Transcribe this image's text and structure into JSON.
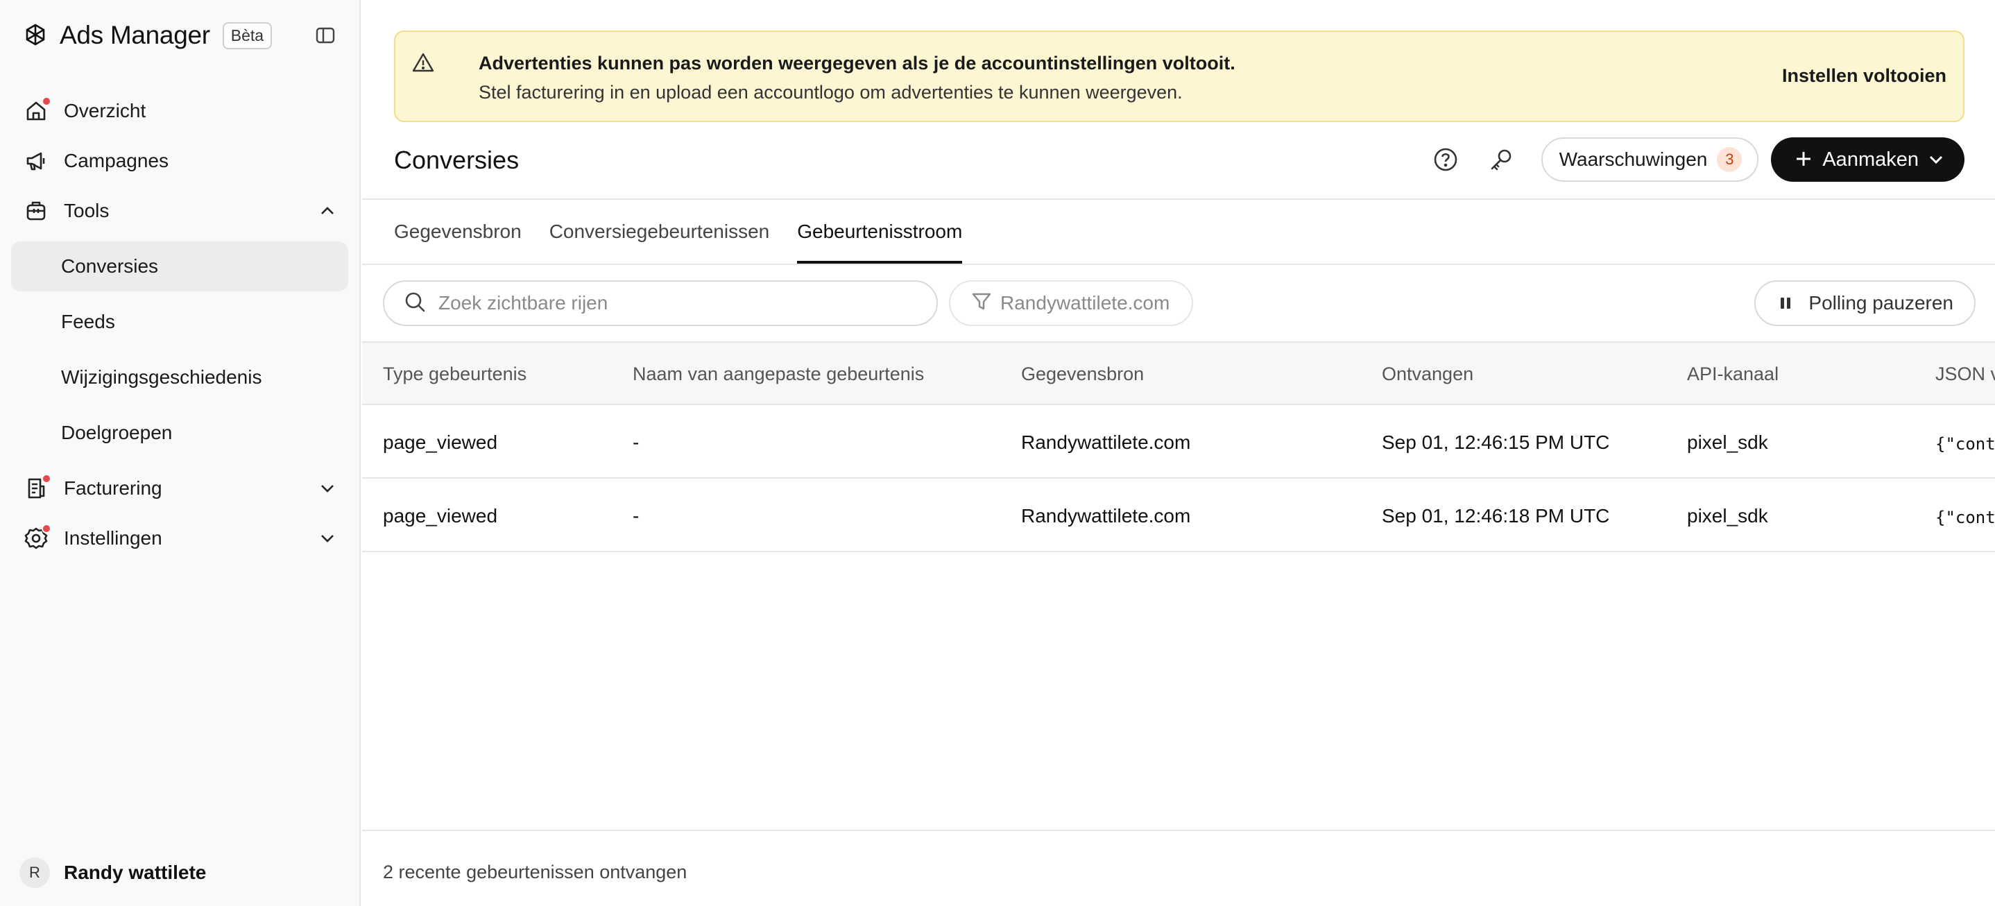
{
  "app": {
    "name": "Ads Manager",
    "badge": "Bèta"
  },
  "sidebar": {
    "items": [
      {
        "label": "Overzicht",
        "icon": "home-icon",
        "notification": true
      },
      {
        "label": "Campagnes",
        "icon": "megaphone-icon",
        "notification": false
      },
      {
        "label": "Tools",
        "icon": "toolbox-icon",
        "notification": false,
        "expanded": true,
        "children": [
          "Conversies",
          "Feeds",
          "Wijzigingsgeschiedenis",
          "Doelgroepen"
        ],
        "active_child": "Conversies"
      },
      {
        "label": "Facturering",
        "icon": "billing-icon",
        "notification": true,
        "expanded": false
      },
      {
        "label": "Instellingen",
        "icon": "settings-gear-icon",
        "notification": true,
        "expanded": false
      }
    ],
    "user": {
      "initial": "R",
      "name": "Randy wattilete"
    }
  },
  "banner": {
    "title": "Advertenties kunnen pas worden weergegeven als je de accountinstellingen voltooit.",
    "message": "Stel facturering in en upload een accountlogo om advertenties te kunnen weergeven.",
    "action": "Instellen voltooien",
    "icon": "warning-triangle-icon",
    "color": "#fdf6d3"
  },
  "header": {
    "title": "Conversies",
    "warnings_label": "Waarschuwingen",
    "warnings_count": "3",
    "create_label": "Aanmaken"
  },
  "tabs": [
    {
      "label": "Gegevensbron",
      "active": false
    },
    {
      "label": "Conversiegebeurtenissen",
      "active": false
    },
    {
      "label": "Gebeurtenisstroom",
      "active": true
    }
  ],
  "toolbar": {
    "search_placeholder": "Zoek zichtbare rijen",
    "filter_label": "Randywattilete.com",
    "polling_label": "Polling pauzeren"
  },
  "table": {
    "columns": [
      "Type gebeurtenis",
      "Naam van aangepaste gebeurtenis",
      "Gegevensbron",
      "Ontvangen",
      "API-kanaal",
      "JSON v"
    ],
    "rows": [
      [
        "page_viewed",
        "-",
        "Randywattilete.com",
        "Sep 01, 12:46:15 PM UTC",
        "pixel_sdk",
        "{\"cont"
      ],
      [
        "page_viewed",
        "-",
        "Randywattilete.com",
        "Sep 01, 12:46:18 PM UTC",
        "pixel_sdk",
        "{\"cont"
      ]
    ]
  },
  "footer": {
    "status": "2 recente gebeurtenissen ontvangen"
  },
  "colors": {
    "primary_button": "#111111",
    "notification_dot": "#e5484d",
    "warning_badge_bg": "#fde3d6",
    "warning_badge_text": "#c2410c"
  }
}
